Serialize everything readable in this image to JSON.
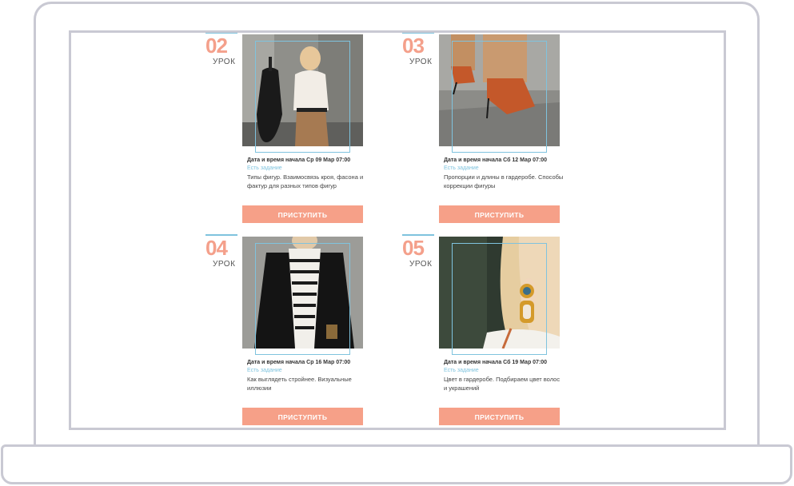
{
  "lessons": [
    {
      "number": "02",
      "label": "УРОК",
      "date": "Дата и время начала Ср 09 Мар 07:00",
      "task": "Есть задание",
      "description": "Типы фигур. Взаимосвязь кроя, фасона и фактур для разных типов фигур",
      "button": "ПРИСТУПИТЬ"
    },
    {
      "number": "03",
      "label": "УРОК",
      "date": "Дата и время начала Сб 12 Мар 07:00",
      "task": "Есть задание",
      "description": "Пропорции и длины в гардеробе. Способы коррекции фигуры",
      "button": "ПРИСТУПИТЬ"
    },
    {
      "number": "04",
      "label": "УРОК",
      "date": "Дата и время начала Ср 16 Мар 07:00",
      "task": "Есть задание",
      "description": "Как выглядеть стройнее. Визуальные иллюзии",
      "button": "ПРИСТУПИТЬ"
    },
    {
      "number": "05",
      "label": "УРОК",
      "date": "Дата и время начала Сб 19 Мар 07:00",
      "task": "Есть задание",
      "description": "Цвет в гардеробе. Подбираем цвет волос и украшений",
      "button": "ПРИСТУПИТЬ"
    }
  ],
  "colors": {
    "accent": "#f6a088",
    "outline": "#7fc3de",
    "frame": "#c9c9d3"
  }
}
